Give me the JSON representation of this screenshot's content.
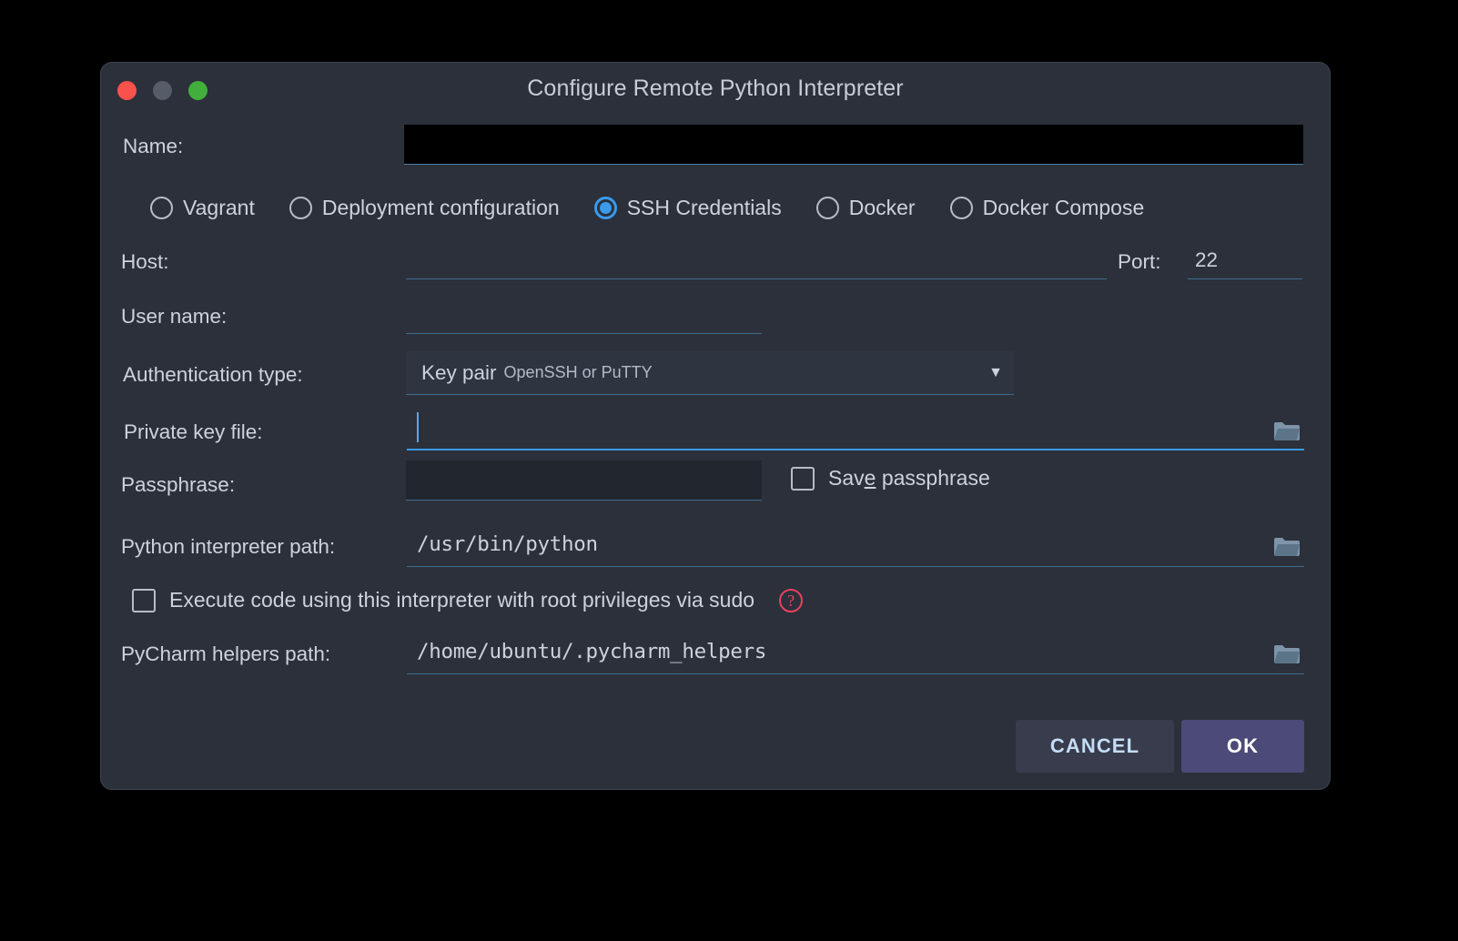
{
  "window": {
    "title": "Configure Remote Python Interpreter",
    "controls": {
      "close": "close-button",
      "minimize": "minimize-button",
      "zoom": "zoom-button"
    }
  },
  "form": {
    "name": {
      "label": "Name:",
      "value": "",
      "redacted": true
    },
    "connection_types": [
      {
        "label": "Vagrant",
        "selected": false
      },
      {
        "label": "Deployment configuration",
        "selected": false
      },
      {
        "label": "SSH Credentials",
        "selected": true
      },
      {
        "label": "Docker",
        "selected": false
      },
      {
        "label": "Docker Compose",
        "selected": false
      }
    ],
    "host": {
      "label": "Host:",
      "value": ""
    },
    "port": {
      "label": "Port:",
      "value": "22"
    },
    "user_name": {
      "label": "User name:",
      "value": ""
    },
    "auth_type": {
      "label": "Authentication type:",
      "value_main": "Key pair",
      "value_sub": "OpenSSH or PuTTY",
      "arrow": "▼"
    },
    "private_key_file": {
      "label": "Private key file:",
      "value": "",
      "focused": true
    },
    "passphrase": {
      "label": "Passphrase:",
      "value": ""
    },
    "save_passphrase": {
      "label_before": "Sav",
      "label_mnemonic": "e",
      "label_after": " passphrase",
      "checked": false
    },
    "python_interpreter_path": {
      "label": "Python interpreter path:",
      "value": "/usr/bin/python"
    },
    "sudo": {
      "label": "Execute code using this interpreter with root privileges via sudo",
      "checked": false,
      "help_glyph": "?"
    },
    "helpers_path": {
      "label": "PyCharm helpers path:",
      "value": "/home/ubuntu/.pycharm_helpers"
    }
  },
  "buttons": {
    "cancel": "CANCEL",
    "ok": "OK"
  },
  "colors": {
    "dialog_bg": "#2b303b",
    "accent_blue": "#3d9ae8",
    "radio_selected": "#3a9bed",
    "underline_idle": "#3d6c8c",
    "help_red": "#e8415f",
    "ok_bg": "#4b4a78",
    "cancel_bg": "#383c4c",
    "folder_icon": "#7e94a8",
    "text": "#cdd2dc"
  }
}
